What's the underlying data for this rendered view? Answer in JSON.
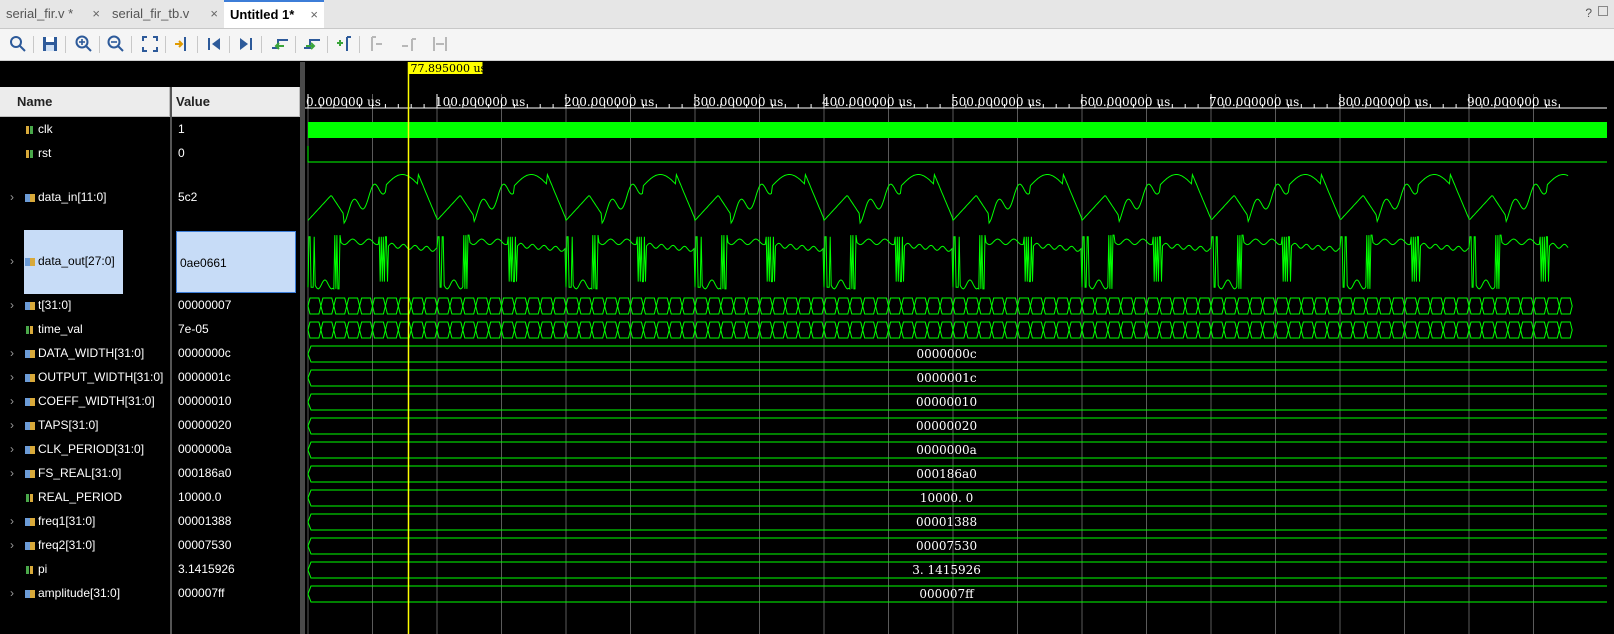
{
  "tabs": [
    {
      "label": "serial_fir.v *",
      "close": "×",
      "active": false
    },
    {
      "label": "serial_fir_tb.v",
      "close": "×",
      "active": false
    },
    {
      "label": "Untitled 1*",
      "close": "×",
      "active": true
    }
  ],
  "window_controls": {
    "help": "?"
  },
  "toolbar": {
    "buttons": [
      "search-icon",
      "save-icon",
      "zoom-in-icon",
      "zoom-out-icon",
      "zoom-fit-icon",
      "go-to-cursor-icon",
      "go-to-time-0-icon",
      "go-to-last-time-icon",
      "previous-transition-icon",
      "next-transition-icon",
      "add-marker-icon",
      "previous-marker-icon",
      "next-marker-icon",
      "swap-cursors-icon"
    ]
  },
  "columns": {
    "name": "Name",
    "value": "Value"
  },
  "cursor": {
    "label": "77.895000 us",
    "time_us": 77.895
  },
  "timeline": {
    "ticks": [
      "0.000000 us",
      "100.000000 us",
      "200.000000 us",
      "300.000000 us",
      "400.000000 us",
      "500.000000 us",
      "600.000000 us",
      "700.000000 us",
      "800.000000 us",
      "900.000000 us"
    ],
    "range_us": [
      0,
      977
    ]
  },
  "signals": [
    {
      "name": "clk",
      "value": "1",
      "kind": "bit",
      "expandable": false,
      "wave": "clock"
    },
    {
      "name": "rst",
      "value": "0",
      "kind": "bit",
      "expandable": false,
      "wave": "low"
    },
    {
      "name": "data_in[11:0]",
      "value": "5c2",
      "kind": "bus",
      "expandable": true,
      "wave": "analog"
    },
    {
      "name": "data_out[27:0]",
      "value": "0ae0661",
      "kind": "bus",
      "expandable": true,
      "wave": "analog2",
      "selected": true
    },
    {
      "name": "t[31:0]",
      "value": "00000007",
      "kind": "bus",
      "expandable": true,
      "wave": "dense"
    },
    {
      "name": "time_val",
      "value": "7e-05",
      "kind": "real",
      "expandable": false,
      "wave": "dense"
    },
    {
      "name": "DATA_WIDTH[31:0]",
      "value": "0000000c",
      "kind": "bus",
      "expandable": true,
      "wave": "const",
      "wave_label": "0000000c"
    },
    {
      "name": "OUTPUT_WIDTH[31:0]",
      "value": "0000001c",
      "kind": "bus",
      "expandable": true,
      "wave": "const",
      "wave_label": "0000001c"
    },
    {
      "name": "COEFF_WIDTH[31:0]",
      "value": "00000010",
      "kind": "bus",
      "expandable": true,
      "wave": "const",
      "wave_label": "00000010"
    },
    {
      "name": "TAPS[31:0]",
      "value": "00000020",
      "kind": "bus",
      "expandable": true,
      "wave": "const",
      "wave_label": "00000020"
    },
    {
      "name": "CLK_PERIOD[31:0]",
      "value": "0000000a",
      "kind": "bus",
      "expandable": true,
      "wave": "const",
      "wave_label": "0000000a"
    },
    {
      "name": "FS_REAL[31:0]",
      "value": "000186a0",
      "kind": "bus",
      "expandable": true,
      "wave": "const",
      "wave_label": "000186a0"
    },
    {
      "name": "REAL_PERIOD",
      "value": "10000.0",
      "kind": "real",
      "expandable": false,
      "wave": "const",
      "wave_label": "10000. 0"
    },
    {
      "name": "freq1[31:0]",
      "value": "00001388",
      "kind": "bus",
      "expandable": true,
      "wave": "const",
      "wave_label": "00001388"
    },
    {
      "name": "freq2[31:0]",
      "value": "00007530",
      "kind": "bus",
      "expandable": true,
      "wave": "const",
      "wave_label": "00007530"
    },
    {
      "name": "pi",
      "value": "3.1415926",
      "kind": "real",
      "expandable": false,
      "wave": "const",
      "wave_label": "3. 1415926"
    },
    {
      "name": "amplitude[31:0]",
      "value": "000007ff",
      "kind": "bus",
      "expandable": true,
      "wave": "const",
      "wave_label": "000007ff"
    }
  ],
  "colors": {
    "wave": "#00ff00",
    "cursor": "#ffff00",
    "background": "#000000",
    "grid": "#5a5a5a",
    "selection": "#c7dcf7",
    "accent": "#3c7dd8"
  }
}
